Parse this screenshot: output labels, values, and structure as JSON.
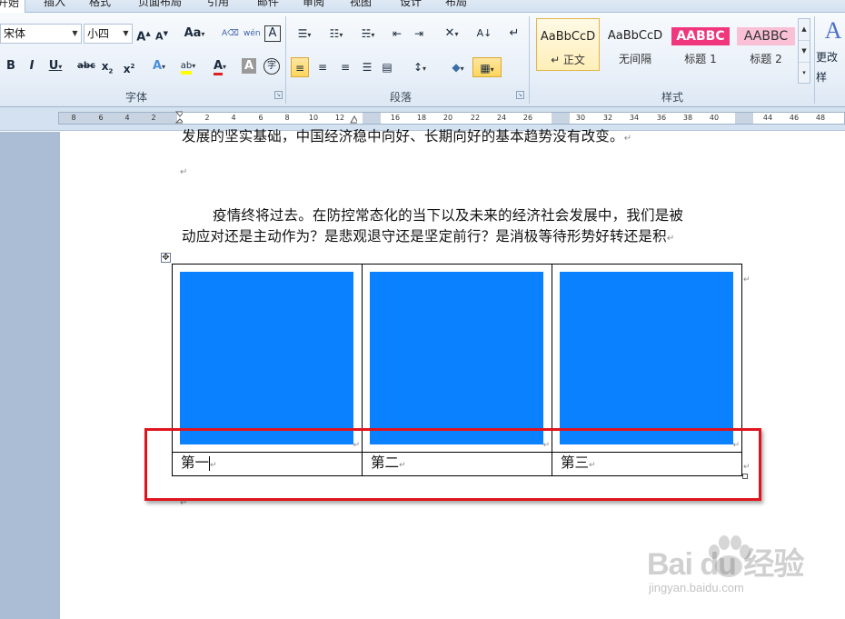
{
  "tabs": [
    "开始",
    "插入",
    "格式",
    "页面布局",
    "引用",
    "邮件",
    "审阅",
    "视图",
    "设计",
    "布局"
  ],
  "ribbon": {
    "font_name": "宋体",
    "font_size": "小四",
    "group_font": "字体",
    "group_paragraph": "段落",
    "group_styles": "样式",
    "change_styles": "更改样",
    "styles": [
      {
        "sample": "AaBbCcD",
        "name": "↵ 正文"
      },
      {
        "sample": "AaBbCcD",
        "name": "无间隔"
      },
      {
        "sample": "AABBC",
        "name": "标题 1"
      },
      {
        "sample": "AABBC",
        "name": "标题 2"
      }
    ]
  },
  "ruler": {
    "left_ticks": [
      "8",
      "6",
      "4",
      "2"
    ],
    "right_ticks": [
      "2",
      "4",
      "6",
      "8",
      "10",
      "12",
      "16",
      "18",
      "20",
      "22",
      "24",
      "26",
      "30",
      "32",
      "34",
      "36",
      "38",
      "40",
      "44",
      "46",
      "48"
    ]
  },
  "document": {
    "line_top": "发展的坚实基础，中国经济稳中向好、长期向好的基本趋势没有改变。",
    "para_line1": "疫情终将过去。在防控常态化的当下以及未来的经济社会发展中，我们是被",
    "para_line2": "动应对还是主动作为？是悲观退守还是坚定前行？是消极等待形势好转还是积",
    "captions": [
      "第一",
      "第二",
      "第三"
    ]
  },
  "colors": {
    "image_placeholder": "#0a82ff",
    "highlight_border": "#e0141e"
  },
  "watermark": {
    "text": "Bai du 经验",
    "url": "jingyan.baidu.com"
  }
}
